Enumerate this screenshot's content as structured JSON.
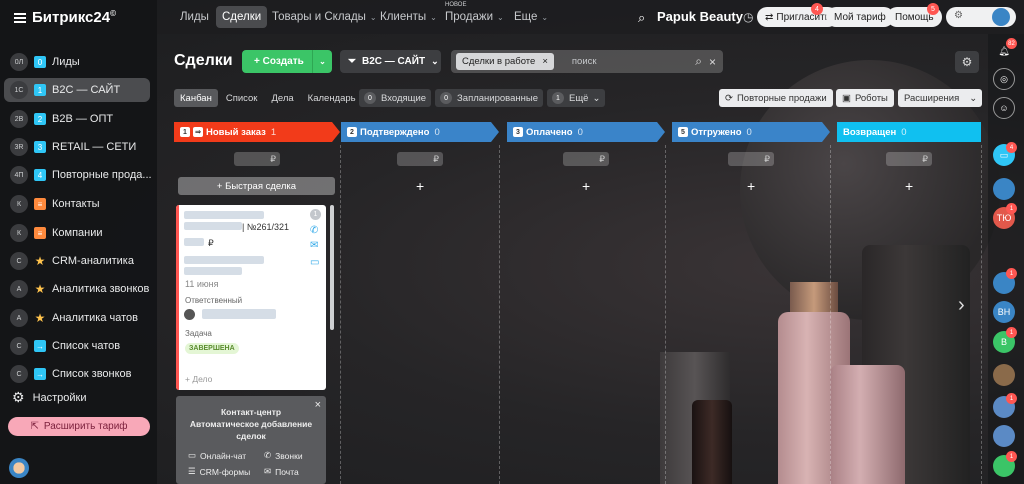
{
  "app": {
    "logo": "Битрикс24",
    "logo_mark": "©"
  },
  "sidebar": {
    "items": [
      {
        "code": "0Л",
        "sq": "0",
        "label": "Лиды",
        "style": "blue"
      },
      {
        "code": "1С",
        "sq": "1",
        "label": "B2C — САЙТ",
        "style": "blue",
        "active": true
      },
      {
        "code": "2В",
        "sq": "2",
        "label": "B2B — ОПТ",
        "style": "blue"
      },
      {
        "code": "3R",
        "sq": "3",
        "label": "RETAIL — СЕТИ",
        "style": "blue"
      },
      {
        "code": "4П",
        "sq": "4",
        "label": "Повторные прода...",
        "style": "blue"
      },
      {
        "code": "К",
        "sq": "≡",
        "label": "Контакты",
        "style": "orange"
      },
      {
        "code": "К",
        "sq": "≡",
        "label": "Компании",
        "style": "orange"
      },
      {
        "code": "С",
        "sq": "★",
        "label": "CRM-аналитика",
        "style": "star"
      },
      {
        "code": "А",
        "sq": "★",
        "label": "Аналитика звонков",
        "style": "star"
      },
      {
        "code": "А",
        "sq": "★",
        "label": "Аналитика чатов",
        "style": "star"
      },
      {
        "code": "С",
        "sq": "→",
        "label": "Список чатов",
        "style": "blue"
      },
      {
        "code": "С",
        "sq": "→",
        "label": "Список звонков",
        "style": "blue"
      }
    ],
    "settings_label": "Настройки",
    "expand_label": "Расширить тариф"
  },
  "topnav": {
    "items": [
      "Лиды",
      "Сделки",
      "Товары и Склады",
      "Клиенты",
      "Продажи",
      "Еще"
    ],
    "new_tag": "НОВОЕ",
    "company": "Papuk Beauty",
    "invite": "Пригласить",
    "invite_badge": "4",
    "tariff": "Мой тариф",
    "help": "Помощь",
    "help_badge": "5"
  },
  "page": {
    "title": "Сделки",
    "create": "Создать",
    "funnel": "B2C — САЙТ",
    "filter_chip": "Сделки в работе",
    "search_placeholder": "поиск"
  },
  "views": {
    "tabs": [
      "Канбан",
      "Список",
      "Дела",
      "Календарь"
    ],
    "counters": [
      {
        "n": "0",
        "label": "Входящие"
      },
      {
        "n": "0",
        "label": "Запланированные"
      },
      {
        "n": "1",
        "label": "Ещё"
      }
    ],
    "repeat_sales": "Повторные продажи",
    "robots": "Роботы",
    "extensions": "Расширения"
  },
  "columns": [
    {
      "num": "1",
      "title": "Новый заказ",
      "count": "1",
      "color": "#f23b1a"
    },
    {
      "num": "2",
      "title": "Подтверждено",
      "count": "0",
      "color": "#3a84c9"
    },
    {
      "num": "3",
      "title": "Оплачено",
      "count": "0",
      "color": "#3a84c9"
    },
    {
      "num": "5",
      "title": "Отгружено",
      "count": "0",
      "color": "#3a84c9"
    },
    {
      "num": "",
      "title": "Возвращен",
      "count": "0",
      "color": "#10c0f0"
    }
  ],
  "currency": "₽",
  "quick_deal": "+ Быстрая сделка",
  "card": {
    "order_no": "| №261/321",
    "price": "₽",
    "date": "11 июня",
    "responsible_label": "Ответственный",
    "task_label": "Задача",
    "task_status": "ЗАВЕРШЕНА",
    "add_activity": "+ Дело",
    "activity_count": "1"
  },
  "contact_center": {
    "title_line1": "Контакт-центр",
    "title_line2": "Автоматическое добавление",
    "title_line3": "сделок",
    "items": [
      "Онлайн-чат",
      "Звонки",
      "CRM-формы",
      "Почта"
    ]
  },
  "rail": {
    "badges": [
      "82",
      "4",
      "1",
      "1",
      "1",
      "1",
      "1"
    ],
    "initials": [
      "ТЮ",
      "ВН",
      "В"
    ]
  }
}
